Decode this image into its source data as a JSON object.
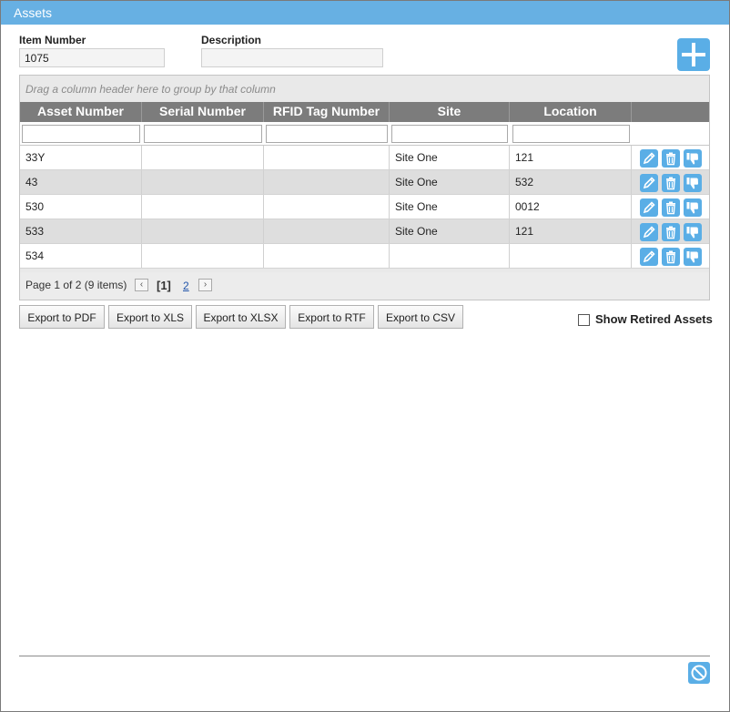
{
  "window": {
    "title": "Assets"
  },
  "form": {
    "item_number_label": "Item Number",
    "item_number_value": "1075",
    "description_label": "Description",
    "description_value": ""
  },
  "grid": {
    "group_panel_text": "Drag a column header here to group by that column",
    "columns": [
      "Asset Number",
      "Serial Number",
      "RFID Tag Number",
      "Site",
      "Location"
    ],
    "rows": [
      {
        "asset_number": "33Y",
        "serial_number": "",
        "rfid_tag": "",
        "site": "Site One",
        "location": "121"
      },
      {
        "asset_number": "43",
        "serial_number": "",
        "rfid_tag": "",
        "site": "Site One",
        "location": "532"
      },
      {
        "asset_number": "530",
        "serial_number": "",
        "rfid_tag": "",
        "site": "Site One",
        "location": "0012"
      },
      {
        "asset_number": "533",
        "serial_number": "",
        "rfid_tag": "",
        "site": "Site One",
        "location": "121"
      },
      {
        "asset_number": "534",
        "serial_number": "",
        "rfid_tag": "",
        "site": "",
        "location": ""
      }
    ],
    "row_action_icons": [
      "pencil-icon",
      "trash-icon",
      "thumbs-down-icon"
    ],
    "pager": {
      "summary": "Page 1 of 2 (9 items)",
      "prev_glyph": "‹",
      "current_page": "[1]",
      "other_page": "2",
      "next_glyph": "›"
    }
  },
  "exports": {
    "pdf": "Export to PDF",
    "xls": "Export to XLS",
    "xlsx": "Export to XLSX",
    "rtf": "Export to RTF",
    "csv": "Export to CSV"
  },
  "show_retired": {
    "label": "Show Retired Assets",
    "checked": false
  },
  "colors": {
    "title_bar": "#67b0e3",
    "accent": "#5aaee6",
    "header": "#7c7c7c"
  }
}
